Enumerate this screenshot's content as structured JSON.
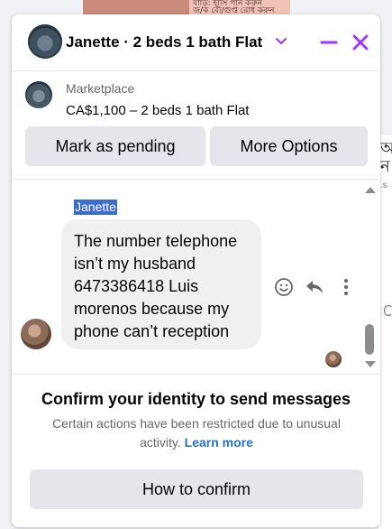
{
  "background": {
    "banner_text_line1": "বাড়ি: হাসি পান করুন",
    "banner_text_line2": "জ/ক বৌ/গুপ্ত রোধ করুন",
    "right_glyph_1": "আ",
    "right_glyph_2": "ন",
    "right_glyph_3": ".s"
  },
  "header": {
    "title": "Janette · 2 beds 1 bath Flat",
    "chevron_icon": "chevron-down-icon",
    "minimize_icon": "minus-icon",
    "close_icon": "close-icon",
    "accent_color": "#a033ff"
  },
  "listing": {
    "label": "Marketplace",
    "price_title": "CA$1,100 – 2 beds 1 bath Flat"
  },
  "actions": {
    "mark_pending": "Mark as pending",
    "more_options": "More Options"
  },
  "messages": {
    "sender_name": "Janette",
    "text": "The number telephone isn’t my husband 6473386418 Luis morenos because my phone can’t reception",
    "icons": [
      "smiley-icon",
      "reply-icon",
      "more-vertical-icon"
    ]
  },
  "restriction": {
    "title": "Confirm your identity to send messages",
    "body": "Certain actions have been restricted due to unusual activity.",
    "link": "Learn more",
    "button": "How to confirm"
  }
}
